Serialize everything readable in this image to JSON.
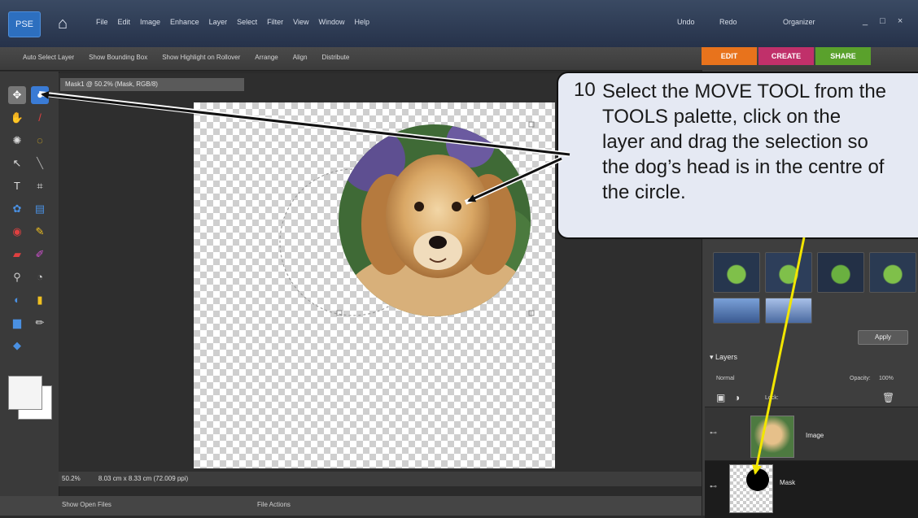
{
  "app": {
    "logo": "PSE",
    "menus": [
      "File",
      "Edit",
      "Image",
      "Enhance",
      "Layer",
      "Select",
      "Filter",
      "View",
      "Window",
      "Help"
    ],
    "undo": "Undo",
    "redo": "Redo",
    "organizer": "Organizer",
    "window_controls": "_ □ ×"
  },
  "options_bar": {
    "items": [
      "Auto Select Layer",
      "Show Bounding Box",
      "Show Highlight on Rollover",
      "Arrange",
      "Align",
      "Distribute"
    ]
  },
  "tabs": [
    {
      "label": "EDIT",
      "color": "#e8731c"
    },
    {
      "label": "CREATE",
      "color": "#c0306a"
    },
    {
      "label": "SHARE",
      "color": "#5aa12c"
    }
  ],
  "document": {
    "title": "Mask1 @ 50.2% (Mask, RGB/8)",
    "zoom": "50.2%",
    "size": "8.03 cm x 8.33 cm (72.009 ppi)",
    "bottom_left": "Show Open Files",
    "bottom_center": "File Actions"
  },
  "panel": {
    "effects_button": "Apply",
    "layers_title": "Layers",
    "blend_mode": "Normal",
    "opacity_label": "Opacity:",
    "opacity_value": "100%",
    "lock_label": "Lock:",
    "layers": [
      {
        "name": "Image"
      },
      {
        "name": "Mask"
      }
    ]
  },
  "callout": {
    "number": "10",
    "lines": [
      "Select the MOVE TOOL from the",
      "TOOLS palette, click on the",
      "layer and drag the selection so",
      "the dog’s head is in the centre of",
      "the circle."
    ]
  },
  "icons": {
    "tools": [
      "move-tool",
      "zoom-tool",
      "hand-tool",
      "eyedropper-tool",
      "magic-wand-tool",
      "lasso-tool",
      "quick-selection-tool",
      "straighten-tool",
      "type-tool",
      "crop-tool",
      "cookie-cutter-tool",
      "shape-tool",
      "red-eye-tool",
      "brush-tool",
      "eraser-tool",
      "smart-brush-tool",
      "clone-stamp-tool",
      "blur-tool",
      "sponge-tool",
      "gradient-tool",
      "paint-bucket-tool",
      "pencil-tool",
      "custom-shape-tool"
    ]
  },
  "colors": {
    "callout_bg": "#e5e9f3",
    "arrow_black": "#111111",
    "arrow_yellow": "#f2e600"
  }
}
